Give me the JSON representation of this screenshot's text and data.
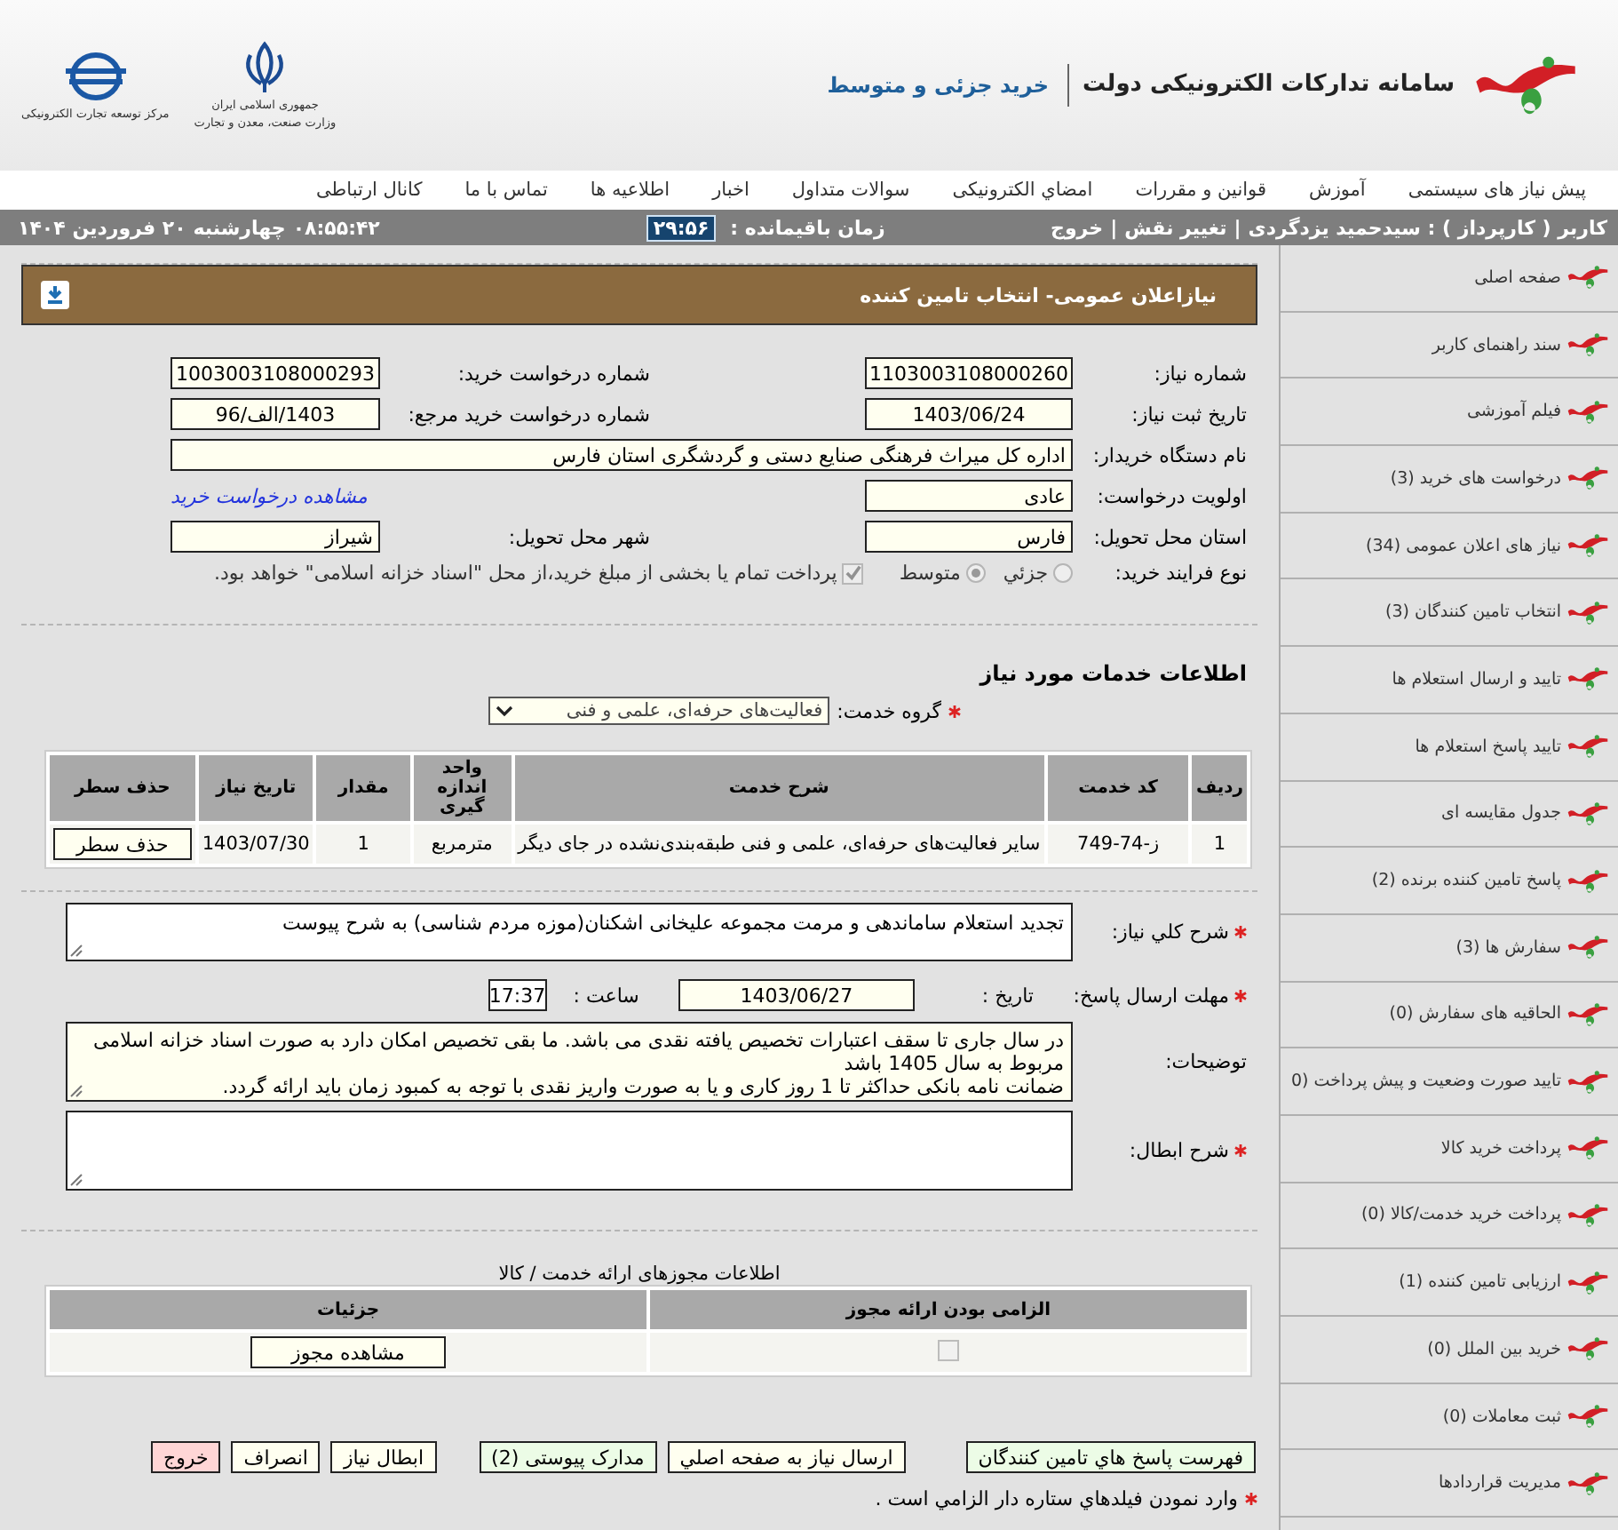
{
  "header": {
    "title": "سامانه تدارکات الکترونیکی دولت",
    "subtitle": "خرید جزئی و متوسط",
    "emblems": [
      {
        "kind": "state",
        "lines": [
          "جمهوری اسلامی ایران",
          "وزارت صنعت، معدن و تجارت"
        ]
      },
      {
        "kind": "globe",
        "lines": [
          "مرکز توسعه تجارت الکترونیکی"
        ]
      }
    ]
  },
  "nav": {
    "items": [
      "پیش نیاز های سیستمی",
      "آموزش",
      "قوانین و مقررات",
      "امضاي الکترونیکی",
      "سوالات متداول",
      "اخبار",
      "اطلاعیه ها",
      "تماس با ما",
      "کانال ارتباطی"
    ]
  },
  "status_bar": {
    "user": "کاربر ( کارپرداز ) : سیدحمید یزدگردی",
    "separator": "|",
    "links": [
      "تغییر نقش",
      "خروج"
    ],
    "remaining_label": "زمان باقیمانده :",
    "remaining": "۲۹:۵۶",
    "clock": "۰۸:۵۵:۴۲",
    "date": "چهارشنبه ۲۰ فروردین ۱۴۰۴"
  },
  "sidebar": {
    "items": [
      "صفحه اصلی",
      "سند راهنمای کاربر",
      "فیلم آموزشی",
      "درخواست های خرید (3)",
      "نیاز های اعلان عمومی (34)",
      "انتخاب تامین کنندگان (3)",
      "تایید و ارسال استعلام ها",
      "تایید پاسخ استعلام ها",
      "جدول مقایسه ای",
      "پاسخ تامین کننده برنده (2)",
      "سفارش ها (3)",
      "الحاقیه های سفارش (0)",
      "تایید صورت وضعیت و پیش پرداخت (0",
      "پرداخت خرید کالا",
      "پرداخت خرید خدمت/کالا (0)",
      "ارزیابی تامین کننده (1)",
      "خرید بین الملل  (0)",
      "ثبت معاملات  (0)",
      "مدیریت قراردادها"
    ]
  },
  "panel": {
    "title": "نیازاعلان عمومی- انتخاب تامین کننده"
  },
  "need_info": {
    "need_number": {
      "label": "شماره نیاز:",
      "value": "1103003108000260"
    },
    "purchase_request_number": {
      "label": "شماره درخواست خرید:",
      "value": "1003003108000293"
    },
    "need_date": {
      "label": "تاریخ ثبت نیاز:",
      "value": "1403/06/24"
    },
    "reference_request_number": {
      "label": "شماره درخواست خرید مرجع:",
      "value": "1403/الف/96"
    },
    "buyer": {
      "label": "نام دستگاه خریدار:",
      "value": "اداره کل میراث فرهنگی  صنایع دستی و گردشگری استان فارس"
    },
    "priority": {
      "label": "اولویت درخواست:",
      "value": "عادی"
    },
    "view_request_link": "مشاهده درخواست خرید",
    "province": {
      "label": "استان محل تحویل:",
      "value": "فارس"
    },
    "city": {
      "label": "شهر محل تحویل:",
      "value": "شیراز"
    },
    "process": {
      "label": "نوع فرایند خرید:",
      "disabled": true,
      "options": [
        {
          "label": "جزئي",
          "selected": false
        },
        {
          "label": "متوسط",
          "selected": true
        }
      ]
    },
    "treasury": {
      "label": "پرداخت تمام یا بخشی از مبلغ خرید،از محل \"اسناد خزانه اسلامی\" خواهد بود.",
      "checked": true,
      "disabled": true
    }
  },
  "services": {
    "title": "اطلاعات خدمات مورد نیاز",
    "group": {
      "label": "گروه خدمت:",
      "required": true,
      "value": "فعالیت‌های حرفه‌ای، علمی و فنی"
    },
    "table": {
      "columns": [
        "ردیف",
        "کد خدمت",
        "شرح خدمت",
        "واحد اندازه گیری",
        "مقدار",
        "تاریخ نیاز",
        "حذف سطر"
      ],
      "rows": [
        {
          "cells": [
            "1",
            "ز-74-749",
            "سایر فعالیت‌های حرفه‌ای، علمی و فنی طبقه‌بندی‌نشده در جای دیگر",
            "مترمربع",
            "1",
            "1403/07/30"
          ],
          "delete_button": "حذف سطر"
        }
      ]
    }
  },
  "details": {
    "description": {
      "label": "شرح کلي نياز:",
      "required": true,
      "value": "تجدید استعلام ساماندهی و مرمت مجموعه علیخانی اشکنان(موزه مردم شناسی) به شرح پیوست"
    },
    "deadline": {
      "label": "مهلت ارسال پاسخ:",
      "required": true,
      "date_label": "تاریخ :",
      "date": "1403/06/27",
      "time_label": "ساعت :",
      "time": "17:37"
    },
    "notes": {
      "label": "توضیحات:",
      "required": false,
      "lines": [
        "در سال جاری تا سقف اعتبارات تخصیص یافته نقدی می باشد. ما بقی تخصیص امکان دارد به صورت اسناد  خزانه اسلامی مربوط به سال 1405 باشد",
        "ضمانت نامه بانکی حداکثر تا 1 روز کاری و یا به صورت واریز نقدی با توجه به کمبود زمان باید ارائه گردد."
      ]
    },
    "cancel_reason": {
      "label": "شرح ابطال:",
      "required": true
    }
  },
  "permits": {
    "title": "اطلاعات مجوزهای ارائه خدمت / کالا",
    "columns": [
      "الزامی بودن ارائه مجوز",
      "جزئیات"
    ],
    "rows": [
      {
        "checked": false,
        "disabled": true,
        "button": "مشاهده مجوز"
      }
    ]
  },
  "actions": [
    {
      "label": "فهرست پاسخ هاي تامين كنندگان",
      "kind": "highlight"
    },
    {
      "label": "ارسال نياز به صفحه اصلي",
      "kind": "plain"
    },
    {
      "label": "مدارک پیوستی (2)",
      "kind": "highlight"
    },
    {
      "label": "ابطال نیاز",
      "kind": "plain"
    },
    {
      "label": "انصراف",
      "kind": "plain"
    },
    {
      "label": "خروج",
      "kind": "danger"
    }
  ],
  "required_note": {
    "text": "وارد نمودن فیلدهاي ستاره دار الزامي است .",
    "required": true
  }
}
